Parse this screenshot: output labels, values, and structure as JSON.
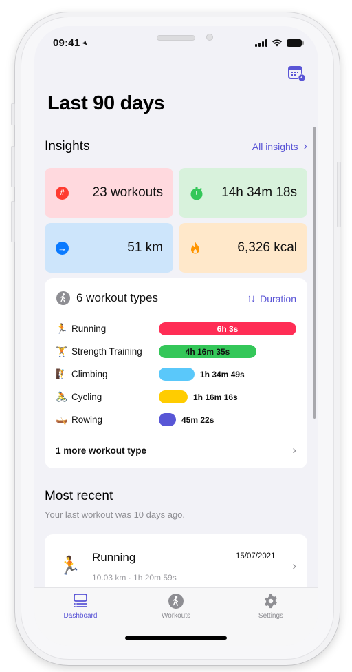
{
  "status_bar": {
    "time": "09:41",
    "location_icon": "location-arrow-icon",
    "signal_icon": "cellular-signal-icon",
    "wifi_icon": "wifi-icon",
    "battery_icon": "battery-icon"
  },
  "header": {
    "calendar_icon": "calendar-clock-icon",
    "title": "Last 90 days"
  },
  "insights": {
    "title": "Insights",
    "link_label": "All insights",
    "tiles": [
      {
        "icon": "hash-icon",
        "value": "23 workouts",
        "color": "#ff3b30",
        "bg": "#ffd9de"
      },
      {
        "icon": "stopwatch-icon",
        "value": "14h 34m 18s",
        "color": "#34c759",
        "bg": "#d8f2dc"
      },
      {
        "icon": "arrow-right-circle-icon",
        "value": "51 km",
        "color": "#0a7aff",
        "bg": "#cde5fb"
      },
      {
        "icon": "flame-icon",
        "value": "6,326 kcal",
        "color": "#ff9500",
        "bg": "#ffe8ca"
      }
    ]
  },
  "workout_types": {
    "title": "6 workout types",
    "icon": "walking-figure-icon",
    "sort_label": "Duration",
    "sort_icon": "sort-arrows-icon",
    "items": [
      {
        "emoji": "🏃",
        "name": "Running",
        "duration": "6h 3s",
        "fraction": 1.0,
        "color": "#ff2d55",
        "label_color": "#ffffff",
        "label_inside": true
      },
      {
        "emoji": "🏋️",
        "name": "Strength Training",
        "duration": "4h 16m 35s",
        "fraction": 0.71,
        "color": "#34c759",
        "label_color": "#111111",
        "label_inside": true
      },
      {
        "emoji": "🧗",
        "name": "Climbing",
        "duration": "1h 34m 49s",
        "fraction": 0.26,
        "color": "#5ac8fa",
        "label_color": "#111111",
        "label_inside": false
      },
      {
        "emoji": "🚴",
        "name": "Cycling",
        "duration": "1h 16m 16s",
        "fraction": 0.21,
        "color": "#ffcc00",
        "label_color": "#111111",
        "label_inside": false
      },
      {
        "emoji": "🛶",
        "name": "Rowing",
        "duration": "45m 22s",
        "fraction": 0.125,
        "color": "#5856d6",
        "label_color": "#111111",
        "label_inside": false
      }
    ],
    "more_label": "1 more workout type"
  },
  "most_recent": {
    "title": "Most recent",
    "subtitle": "Your last workout was 10 days ago.",
    "workout": {
      "emoji": "🏃",
      "name": "Running",
      "date": "15/07/2021",
      "meta": "10.03 km · 1h 20m 59s"
    }
  },
  "tab_bar": {
    "items": [
      {
        "label": "Dashboard",
        "icon": "dashboard-icon",
        "active": true
      },
      {
        "label": "Workouts",
        "icon": "workouts-icon",
        "active": false
      },
      {
        "label": "Settings",
        "icon": "gear-icon",
        "active": false
      }
    ]
  }
}
